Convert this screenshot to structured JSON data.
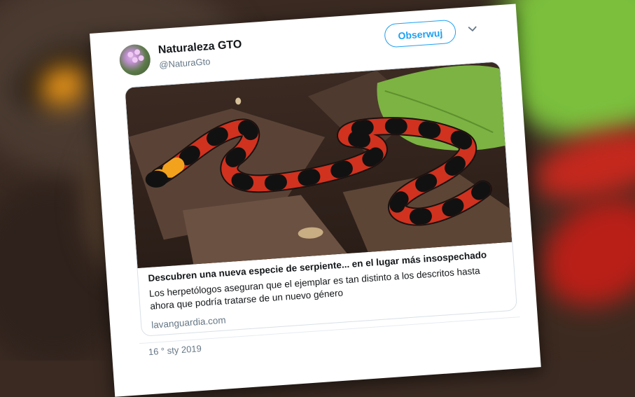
{
  "tweet": {
    "author_name": "Naturaleza GTO",
    "author_handle": "@NaturaGto",
    "follow_label": "Obserwuj",
    "timestamp": "16 ° sty 2019"
  },
  "link_card": {
    "title": "Descubren una nueva especie de serpiente... en el lugar más insospechado",
    "description": "Los herpetólogos aseguran que el ejemplar es tan distinto a los descritos hasta ahora que podría tratarse de un nuevo género",
    "domain": "lavanguardia.com"
  },
  "icons": {
    "avatar": "flower-avatar",
    "menu": "chevron-down-icon"
  },
  "colors": {
    "accent": "#1da1f2",
    "card_bg": "#ffffff",
    "secondary_text": "#657786"
  }
}
